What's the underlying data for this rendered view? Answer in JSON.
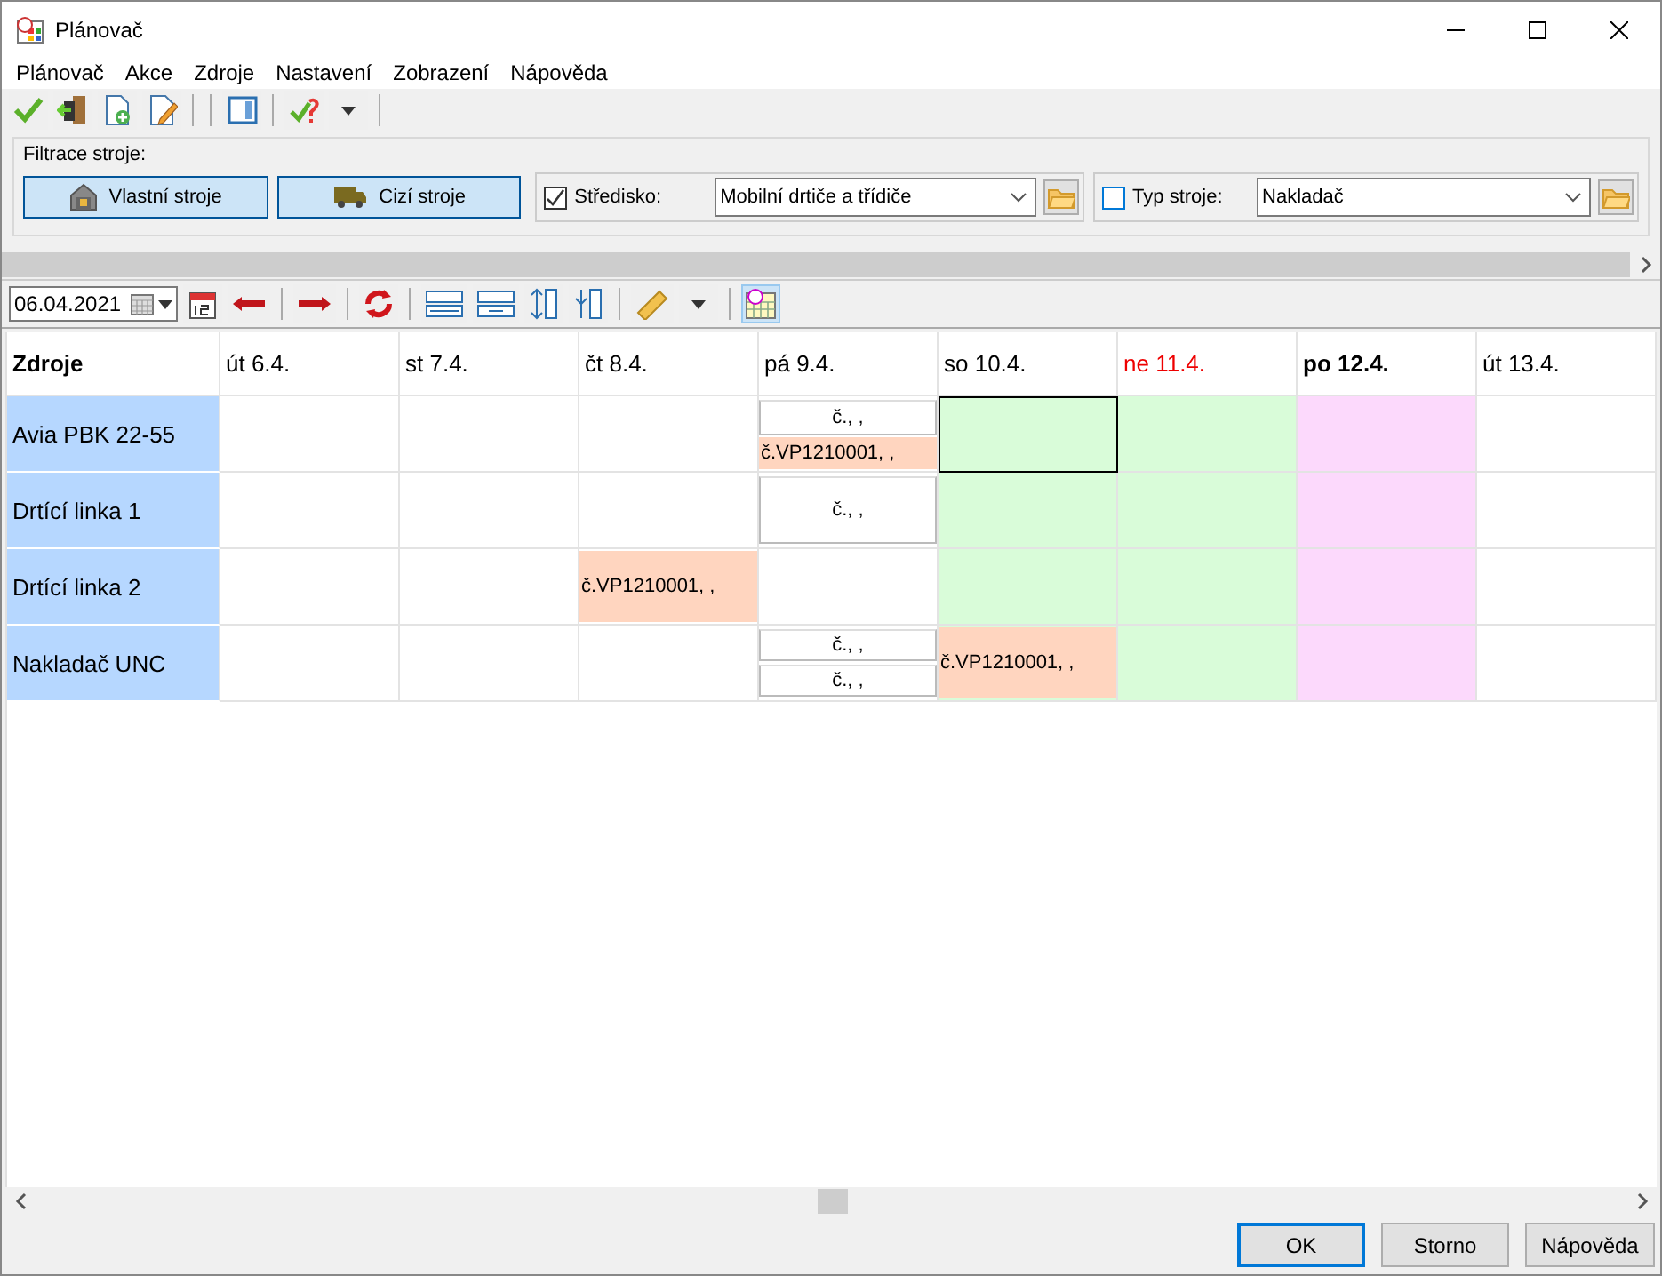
{
  "window": {
    "title": "Plánovač"
  },
  "menu": [
    "Plánovač",
    "Akce",
    "Zdroje",
    "Nastavení",
    "Zobrazení",
    "Nápověda"
  ],
  "filter": {
    "title": "Filtrace stroje:",
    "buttons": [
      {
        "label": "Vlastní stroje",
        "pressed": true
      },
      {
        "label": "Cizí stroje",
        "pressed": true
      }
    ],
    "fields": [
      {
        "label": "Středisko:",
        "checked": true,
        "value": "Mobilní drtiče a třídiče"
      },
      {
        "label": "Typ stroje:",
        "checked": false,
        "value": "Nakladač"
      }
    ]
  },
  "date_field": {
    "value": "06.04.2021"
  },
  "calendar_view_pressed": true,
  "grid": {
    "header": "Zdroje",
    "columns": [
      {
        "label": "út 6.4.",
        "kind": "workday"
      },
      {
        "label": "st 7.4.",
        "kind": "workday"
      },
      {
        "label": "čt 8.4.",
        "kind": "workday"
      },
      {
        "label": "pá 9.4.",
        "kind": "workday"
      },
      {
        "label": "so 10.4.",
        "kind": "weekend"
      },
      {
        "label": "ne 11.4.",
        "kind": "sunday"
      },
      {
        "label": "po 12.4.",
        "kind": "today"
      },
      {
        "label": "út 13.4.",
        "kind": "workday"
      }
    ],
    "rows": [
      {
        "name": "Avia  PBK 22-55",
        "cells": [
          {
            "selected": false
          },
          {
            "selected": false
          },
          {
            "selected": false
          },
          {
            "selected": false,
            "events": [
              {
                "text": "č., ,",
                "kind": "blank"
              },
              {
                "text": "č.VP1210001, ,",
                "kind": "order"
              }
            ]
          },
          {
            "selected": true
          },
          {
            "selected": false
          },
          {
            "selected": false
          },
          {
            "selected": false
          }
        ]
      },
      {
        "name": "Drtící linka 1",
        "cells": [
          {
            "selected": false
          },
          {
            "selected": false
          },
          {
            "selected": false
          },
          {
            "selected": false,
            "events": [
              {
                "text": "č., ,",
                "kind": "blank"
              }
            ]
          },
          {
            "selected": false
          },
          {
            "selected": false
          },
          {
            "selected": false
          },
          {
            "selected": false
          }
        ]
      },
      {
        "name": "Drtící linka 2",
        "cells": [
          {
            "selected": false
          },
          {
            "selected": false
          },
          {
            "selected": false,
            "events": [
              {
                "text": "č.VP1210001, ,",
                "kind": "order"
              }
            ]
          },
          {
            "selected": false
          },
          {
            "selected": false
          },
          {
            "selected": false
          },
          {
            "selected": false
          },
          {
            "selected": false
          }
        ]
      },
      {
        "name": "Nakladač UNC",
        "cells": [
          {
            "selected": false
          },
          {
            "selected": false
          },
          {
            "selected": false
          },
          {
            "selected": false,
            "events": [
              {
                "text": "č., ,",
                "kind": "blank"
              },
              {
                "text": "č., ,",
                "kind": "blank"
              }
            ]
          },
          {
            "selected": false,
            "events": [
              {
                "text": "č.VP1210001, ,",
                "kind": "order"
              }
            ]
          },
          {
            "selected": false
          },
          {
            "selected": false
          },
          {
            "selected": false
          }
        ]
      }
    ]
  },
  "footer_buttons": [
    {
      "label": "OK",
      "default": true
    },
    {
      "label": "Storno",
      "default": false
    },
    {
      "label": "Nápověda",
      "default": false
    }
  ]
}
